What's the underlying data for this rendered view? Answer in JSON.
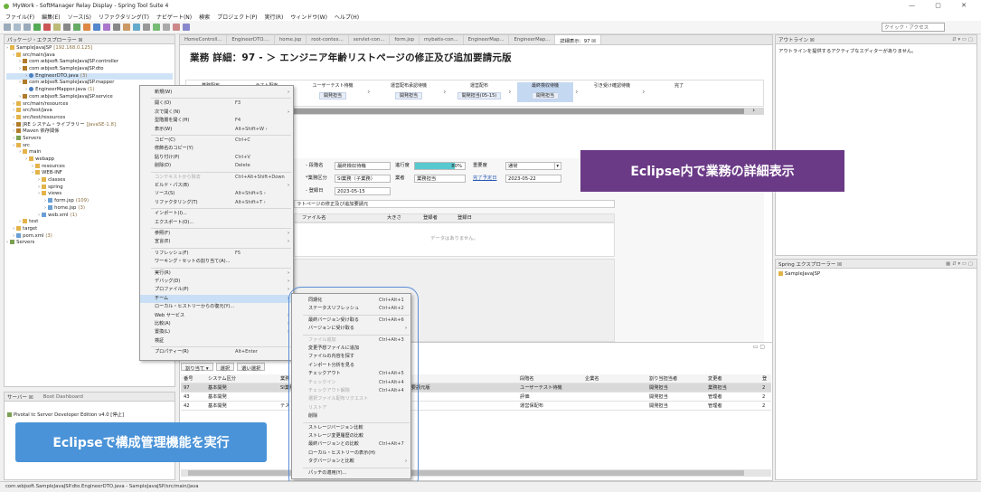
{
  "window": {
    "title": "MyWork - SoftManager Relay Display - Spring Tool Suite 4",
    "controls": "—  ▢  ✕"
  },
  "menubar": [
    "ファイル(F)",
    "編集(E)",
    "ソース(S)",
    "リファクタリング(T)",
    "ナビゲート(N)",
    "検索",
    "プロジェクト(P)",
    "実行(R)",
    "ウィンドウ(W)",
    "ヘルプ(H)"
  ],
  "toolbar": {
    "quick_access_placeholder": "クイック・アクセス"
  },
  "package_explorer": {
    "tab": "パッケージ・エクスプローラー ☒",
    "items": [
      {
        "indent": 0,
        "icon": "project",
        "label": "SampleJavaJSP",
        "extra": "[192.168.0.125]"
      },
      {
        "indent": 1,
        "icon": "fold",
        "label": "src/main/java"
      },
      {
        "indent": 2,
        "icon": "pkg",
        "label": "com.wbjsoft.SampleJavaJSP.controller"
      },
      {
        "indent": 2,
        "icon": "pkg",
        "label": "com.wbjsoft.SampleJavaJSP.dto"
      },
      {
        "indent": 3,
        "icon": "java",
        "label": "EngineerDTO.java",
        "extra": "(3)",
        "selected": true
      },
      {
        "indent": 2,
        "icon": "pkg",
        "label": "com.wbjsoft.SampleJavaJSP.mapper"
      },
      {
        "indent": 3,
        "icon": "java",
        "label": "EngineerMapper.java",
        "extra": "(1)"
      },
      {
        "indent": 2,
        "icon": "pkg",
        "label": "com.wbjsoft.SampleJavaJSP.service"
      },
      {
        "indent": 1,
        "icon": "fold",
        "label": "src/main/resources"
      },
      {
        "indent": 1,
        "icon": "fold",
        "label": "src/test/java"
      },
      {
        "indent": 1,
        "icon": "fold",
        "label": "src/test/resources"
      },
      {
        "indent": 1,
        "icon": "pkg",
        "label": "JRE システム・ライブラリー",
        "extra": "[JavaSE-1.8]"
      },
      {
        "indent": 1,
        "icon": "pkg",
        "label": "Maven 依存関係"
      },
      {
        "indent": 1,
        "icon": "srv",
        "label": "Servers"
      },
      {
        "indent": 1,
        "icon": "fold",
        "label": "src"
      },
      {
        "indent": 2,
        "icon": "fold",
        "label": "main"
      },
      {
        "indent": 3,
        "icon": "fold",
        "label": "webapp"
      },
      {
        "indent": 4,
        "icon": "fold",
        "label": "resources"
      },
      {
        "indent": 4,
        "icon": "fold",
        "label": "WEB-INF"
      },
      {
        "indent": 5,
        "icon": "fold",
        "label": "classes"
      },
      {
        "indent": 5,
        "icon": "fold",
        "label": "spring"
      },
      {
        "indent": 5,
        "icon": "fold",
        "label": "views"
      },
      {
        "indent": 6,
        "icon": "jsp",
        "label": "form.jsp",
        "extra": "(109)"
      },
      {
        "indent": 6,
        "icon": "jsp",
        "label": "home.jsp",
        "extra": "(3)"
      },
      {
        "indent": 5,
        "icon": "jsp",
        "label": "web.xml",
        "extra": "(1)"
      },
      {
        "indent": 2,
        "icon": "fold",
        "label": "test"
      },
      {
        "indent": 1,
        "icon": "fold",
        "label": "target"
      },
      {
        "indent": 1,
        "icon": "jsp",
        "label": "pom.xml",
        "extra": "(3)"
      },
      {
        "indent": 0,
        "icon": "srv",
        "label": "Servers"
      }
    ]
  },
  "servers_panel": {
    "tab": "サーバー ☒",
    "tab2": "Boot Dashboard",
    "item": "Pivotal tc Server Developer Edition v4.0 [停止]"
  },
  "editor": {
    "tabs": [
      "HomeControll...",
      "EngineerDTO....",
      "home.jsp",
      "root-contex...",
      "servlet-con...",
      "form.jsp",
      "mybatis-con...",
      "EngineerMap...",
      "EngineerMap...",
      "詳細表示：97 ☒"
    ],
    "doc_title": "業務 詳細：97 - ＞ エンジニア年齢リストページの修正及び追加要請元版",
    "steps": [
      {
        "title": "業務配布",
        "badge": ""
      },
      {
        "title": "テスト配布",
        "badge": ""
      },
      {
        "title": "ユーザーテスト待機",
        "badge": "開発担当"
      },
      {
        "title": "運営配布承認待機",
        "badge": "開発担当"
      },
      {
        "title": "運営配布",
        "badge": "開発担当(05-15)"
      },
      {
        "title": "最終検収待機",
        "badge": "開発担当",
        "current": true
      },
      {
        "title": "引き受け確認待機",
        "badge": ""
      },
      {
        "title": "完了",
        "badge": ""
      }
    ],
    "form": {
      "l_group": "- 段階名",
      "v_group": "最終検収待機",
      "l_progress": "進行度",
      "v_progress": "80%",
      "progress_frac": 0.8,
      "l_priority": "重要度",
      "v_priority": "通常",
      "l_kind": "*業務区分",
      "v_kind": "SI業務（子業務）",
      "l_owner": "業者",
      "v_owner": "業務担当",
      "l_done": "完了予定日",
      "v_done": "2023-05-22",
      "l_reg": "- 登録日",
      "v_reg": "2023-05-15",
      "desc": "ラトページの修正及び追加要請元",
      "file_h1": "ファイル名",
      "file_h2": "大きさ",
      "file_h3": "登録者",
      "file_h4": "登録日",
      "empty": "データはありません。"
    }
  },
  "context_menu": [
    {
      "label": "新規(W)",
      "submenu": true
    },
    {
      "sep": true
    },
    {
      "label": "開く(O)",
      "sc": "F3"
    },
    {
      "label": "次で開く(N)",
      "submenu": true
    },
    {
      "label": "型階層を開く(H)",
      "sc": "F4"
    },
    {
      "label": "表示(W)",
      "sc": "Alt+Shift+W ›"
    },
    {
      "sep": true
    },
    {
      "label": "コピー(C)",
      "sc": "Ctrl+C"
    },
    {
      "label": "修飾名のコピー(Y)"
    },
    {
      "label": "貼り付け(P)",
      "sc": "Ctrl+V"
    },
    {
      "label": "削除(D)",
      "sc": "Delete"
    },
    {
      "sep": true
    },
    {
      "label": "コンテキストから除去",
      "sc": "Ctrl+Alt+Shift+Down",
      "dis": true
    },
    {
      "label": "ビルド・パス(B)",
      "submenu": true
    },
    {
      "label": "ソース(S)",
      "sc": "Alt+Shift+S ›"
    },
    {
      "label": "リファクタリング(T)",
      "sc": "Alt+Shift+T ›"
    },
    {
      "sep": true
    },
    {
      "label": "インポート(I)..."
    },
    {
      "label": "エクスポート(O)..."
    },
    {
      "sep": true
    },
    {
      "label": "参照(F)",
      "submenu": true
    },
    {
      "label": "宣言(E)",
      "submenu": true
    },
    {
      "sep": true
    },
    {
      "label": "リフレッシュ(F)",
      "sc": "F5"
    },
    {
      "label": "ワーキング・セットの割り当て(A)..."
    },
    {
      "sep": true
    },
    {
      "label": "実行(R)",
      "submenu": true
    },
    {
      "label": "デバッグ(D)",
      "submenu": true
    },
    {
      "label": "プロファイル(P)",
      "submenu": true
    },
    {
      "label": "チーム",
      "submenu": true,
      "hl": true
    },
    {
      "label": "ローカル・ヒストリーからの復元(Y)..."
    },
    {
      "label": "Web サービス",
      "submenu": true
    },
    {
      "label": "比較(A)",
      "submenu": true
    },
    {
      "label": "置換(L)",
      "submenu": true
    },
    {
      "label": "検証"
    },
    {
      "sep": true
    },
    {
      "label": "プロパティー(R)",
      "sc": "Alt+Enter"
    }
  ],
  "team_submenu": [
    {
      "label": "同期化",
      "sc": "Ctrl+Alt+1"
    },
    {
      "label": "ステータスリフレッシュ",
      "sc": "Ctrl+Alt+2"
    },
    {
      "sep": true
    },
    {
      "label": "最終バージョン受け取る",
      "sc": "Ctrl+Alt+6"
    },
    {
      "label": "バージョンに受け取る",
      "submenu": true
    },
    {
      "sep": true
    },
    {
      "label": "ファイル追加",
      "sc": "Ctrl+Alt+3",
      "dis": true
    },
    {
      "label": "変更予想ファイルに追加"
    },
    {
      "label": "ファイルの内容を探す"
    },
    {
      "label": "インポート分析を見る"
    },
    {
      "label": "チェックアウト",
      "sc": "Ctrl+Alt+5"
    },
    {
      "label": "チェックイン",
      "sc": "Ctrl+Alt+4",
      "dis": true
    },
    {
      "label": "チェックアウト解除",
      "sc": "Ctrl+Alt+4",
      "dis": true
    },
    {
      "label": "選択ファイル配布リクエスト",
      "dis": true
    },
    {
      "label": "リストア",
      "dis": true
    },
    {
      "label": "削除"
    },
    {
      "sep": true
    },
    {
      "label": "ストレージバージョン比較"
    },
    {
      "label": "ストレージ変更履歴の比較"
    },
    {
      "label": "最終バージョンとの比較",
      "sc": "Ctrl+Alt+7"
    },
    {
      "label": "ローカル・ヒストリーの表示(H)"
    },
    {
      "label": "タグバージョンと比較",
      "submenu": true
    },
    {
      "sep": true
    },
    {
      "label": "パッチの適用(Y)..."
    }
  ],
  "outline": {
    "tab": "アウトライン ☒",
    "msg": "アウトラインを提供するアクティブなエディターがありません。"
  },
  "spring_explorer": {
    "tab": "Spring エクスプローラー ☒",
    "item": "SampleJavaJSP"
  },
  "bottom_table": {
    "toolbar": [
      "割り当て ▾",
      "選択",
      "選い選択"
    ],
    "headers": [
      "番号",
      "システム区分",
      "業務",
      "段階名",
      "企業名",
      "割り当担当者",
      "変更者",
      "登"
    ],
    "rows": [
      [
        "97",
        "基本開発",
        "SI業務（子業務）エンジニア年齢リストページの修正及び追加要請元版",
        "ユーザーテスト待機",
        "",
        "開発担当",
        "業務担当",
        "2"
      ],
      [
        "43",
        "基本開発",
        "",
        "評価",
        "",
        "開発担当",
        "管理者",
        "2"
      ],
      [
        "42",
        "基本開発",
        "テスト",
        "運営保配布",
        "",
        "開発担当",
        "管理者",
        "2"
      ]
    ]
  },
  "banners": {
    "right": "Eclipse内で業務の詳細表示",
    "left": "Eclipseで構成管理機能を実行"
  },
  "status": "com.wbjsoft.SampleJavaJSP.dto.EngineerDTO.java - SampleJavaJSP/src/main/java"
}
